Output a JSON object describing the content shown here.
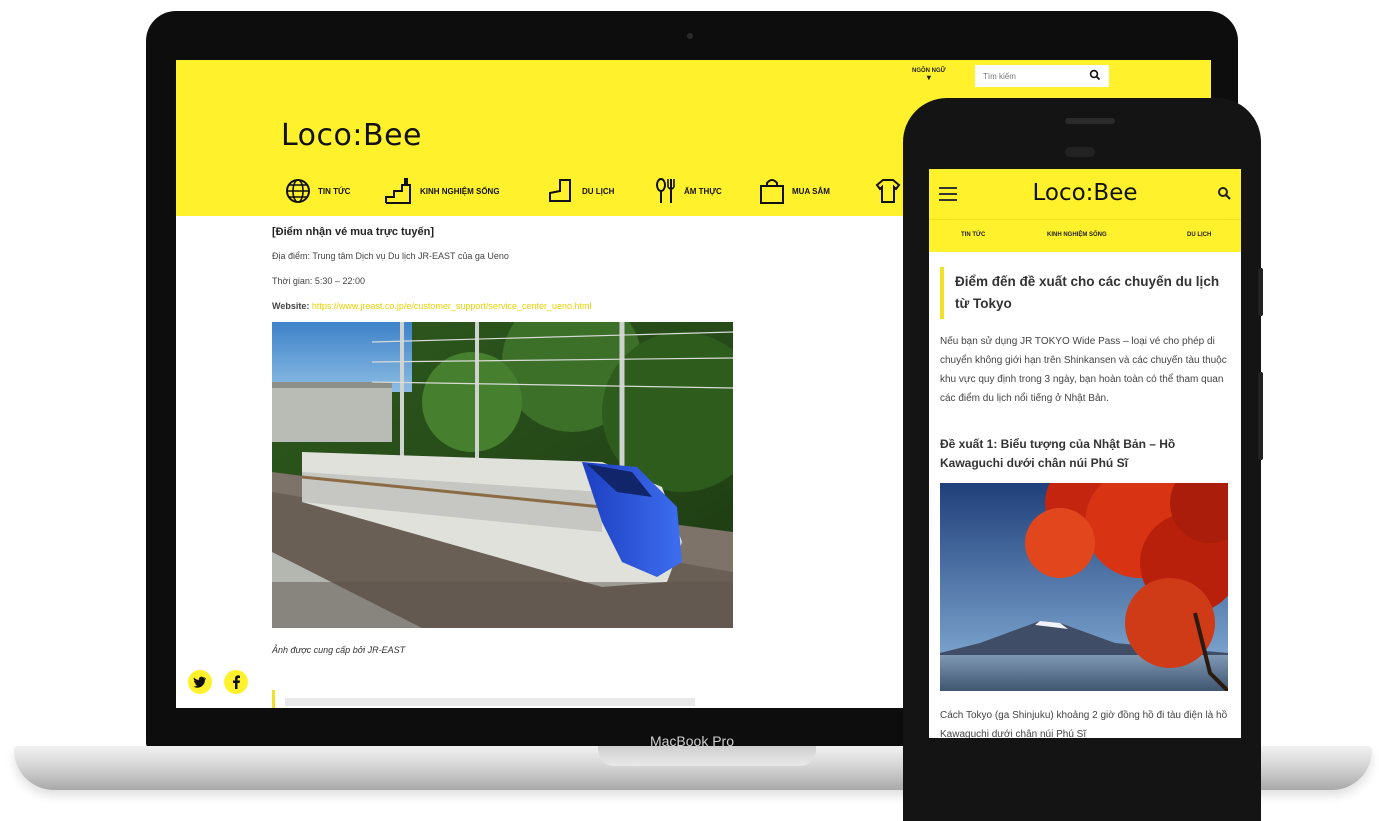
{
  "laptop": {
    "brand_label": "MacBook Pro",
    "header": {
      "language_label": "NGÔN NGỮ",
      "search_placeholder": "Tìm kiếm",
      "logo": "Loco:Bee",
      "nav": [
        {
          "label": "TIN TỨC",
          "icon": "globe-icon"
        },
        {
          "label": "KINH NGHIỆM SỐNG",
          "icon": "stairs-icon"
        },
        {
          "label": "DU LỊCH",
          "icon": "boot-icon"
        },
        {
          "label": "ẨM THỰC",
          "icon": "fork-spoon-icon"
        },
        {
          "label": "MUA SẮM",
          "icon": "shopping-bag-icon"
        }
      ]
    },
    "article": {
      "heading": "[Điểm nhận vé mua trực tuyến]",
      "location": "Địa điểm: Trung tâm Dịch vụ Du lịch JR-EAST của ga Ueno",
      "time": "Thời gian: 5:30 – 22:00",
      "website_label": "Website:",
      "website_url": "https://www.jreast.co.jp/e/customer_support/service_center_ueno.html",
      "caption": "Ảnh được cung cấp bởi JR-EAST"
    },
    "social": [
      "twitter-icon",
      "facebook-icon"
    ]
  },
  "phone": {
    "logo": "Loco:Bee",
    "tabs": [
      "TIN TỨC",
      "KINH NGHIỆM SỐNG",
      "DU LỊCH"
    ],
    "title": "Điểm đến đề xuất cho các chuyến du lịch từ Tokyo",
    "paragraph": "Nếu bạn sử dụng JR TOKYO Wide Pass – loại vé cho phép di chuyển không giới hạn trên Shinkansen và các chuyến tàu thuộc khu vực quy định trong 3 ngày, bạn hoàn toàn có thể tham quan các điểm du lịch nổi tiếng ở Nhật Bản.",
    "subheading": "Đề xuất 1: Biểu tượng của Nhật Bản – Hồ Kawaguchi dưới chân núi Phú Sĩ",
    "paragraph2": "Cách Tokyo (ga Shinjuku) khoảng 2 giờ đồng hồ đi tàu điện là hồ Kawaguchi dưới chân núi Phú Sĩ"
  },
  "colors": {
    "brand_yellow": "#fff22d",
    "link_yellow": "#e8d200",
    "device_black": "#0d0d0d"
  }
}
